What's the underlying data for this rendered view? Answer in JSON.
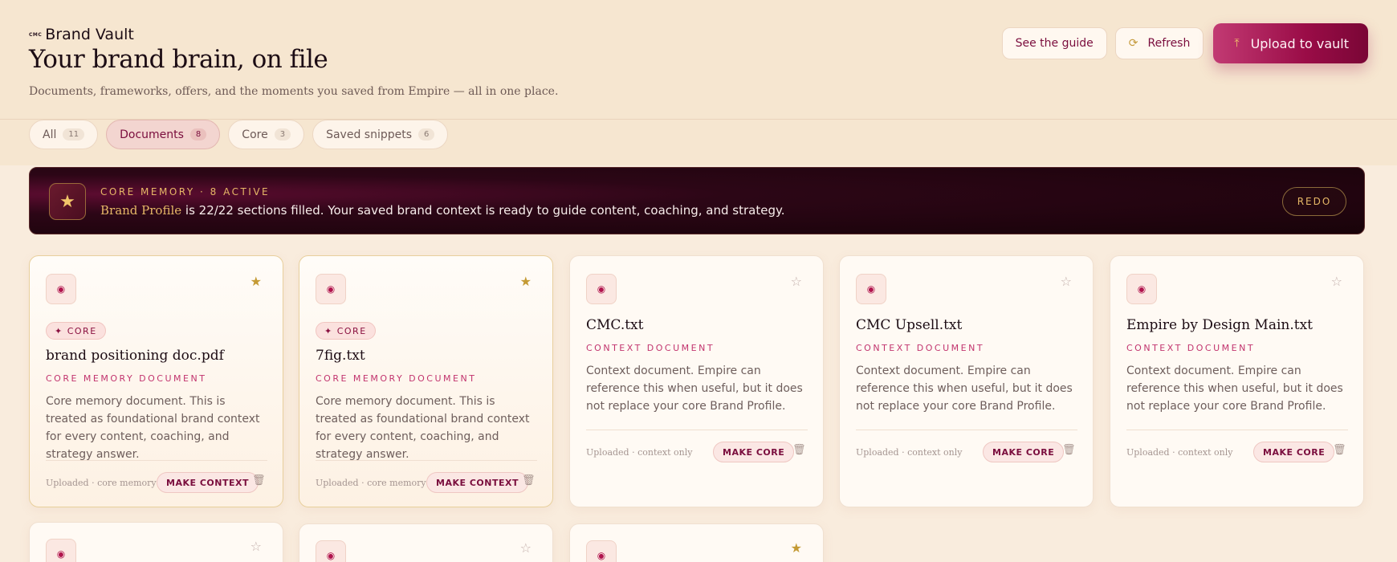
{
  "header": {
    "brand_mark": "CMC",
    "brand_name": "Brand Vault",
    "title": "Your brand brain, on file",
    "subtitle": "Documents, frameworks, offers, and the moments you saved from Empire — all in one place.",
    "guide_label": "See the guide",
    "refresh_label": "Refresh",
    "upload_label": "Upload to vault"
  },
  "tabs": [
    {
      "label": "All",
      "count": "11"
    },
    {
      "label": "Documents",
      "count": "8",
      "active": true
    },
    {
      "label": "Core",
      "count": "3"
    },
    {
      "label": "Saved snippets",
      "count": "6"
    }
  ],
  "banner": {
    "eyebrow": "CORE MEMORY · 8 ACTIVE",
    "highlight": "Brand Profile",
    "text": " is 22/22 sections filled. Your saved brand context is ready to guide content, coaching, and strategy.",
    "redo_label": "REDO"
  },
  "cards": [
    {
      "core": true,
      "starred": true,
      "core_pill": "CORE",
      "title": "brand positioning doc.pdf",
      "kind": "CORE MEMORY DOCUMENT",
      "description": "Core memory document. This is treated as foundational brand context for every content, coaching, and strategy answer.",
      "status": "Uploaded · core memory",
      "action": "MAKE CONTEXT"
    },
    {
      "core": true,
      "starred": true,
      "core_pill": "CORE",
      "title": "7fig.txt",
      "kind": "CORE MEMORY DOCUMENT",
      "description": "Core memory document. This is treated as foundational brand context for every content, coaching, and strategy answer.",
      "status": "Uploaded · core memory",
      "action": "MAKE CONTEXT"
    },
    {
      "core": false,
      "starred": false,
      "title": "CMC.txt",
      "kind": "CONTEXT DOCUMENT",
      "description": "Context document. Empire can reference this when useful, but it does not replace your core Brand Profile.",
      "status": "Uploaded · context only",
      "action": "MAKE CORE"
    },
    {
      "core": false,
      "starred": false,
      "title": "CMC Upsell.txt",
      "kind": "CONTEXT DOCUMENT",
      "description": "Context document. Empire can reference this when useful, but it does not replace your core Brand Profile.",
      "status": "Uploaded · context only",
      "action": "MAKE CORE"
    },
    {
      "core": false,
      "starred": false,
      "title": "Empire by Design Main.txt",
      "kind": "CONTEXT DOCUMENT",
      "description": "Context document. Empire can reference this when useful, but it does not replace your core Brand Profile.",
      "status": "Uploaded · context only",
      "action": "MAKE CORE"
    }
  ],
  "partial_cards": [
    {
      "starred": false
    },
    {
      "starred": false
    },
    {
      "starred": true
    }
  ],
  "icons": {
    "doc": "target-icon",
    "star_on": "★",
    "star_off": "☆",
    "core_pill": "✦",
    "upload": "upload-icon",
    "refresh": "refresh-icon",
    "trash": "trash-icon"
  },
  "colors": {
    "accent": "#9a0c47",
    "gold": "#c49a34",
    "background": "#f6e6d0",
    "banner": "#1c0410"
  }
}
